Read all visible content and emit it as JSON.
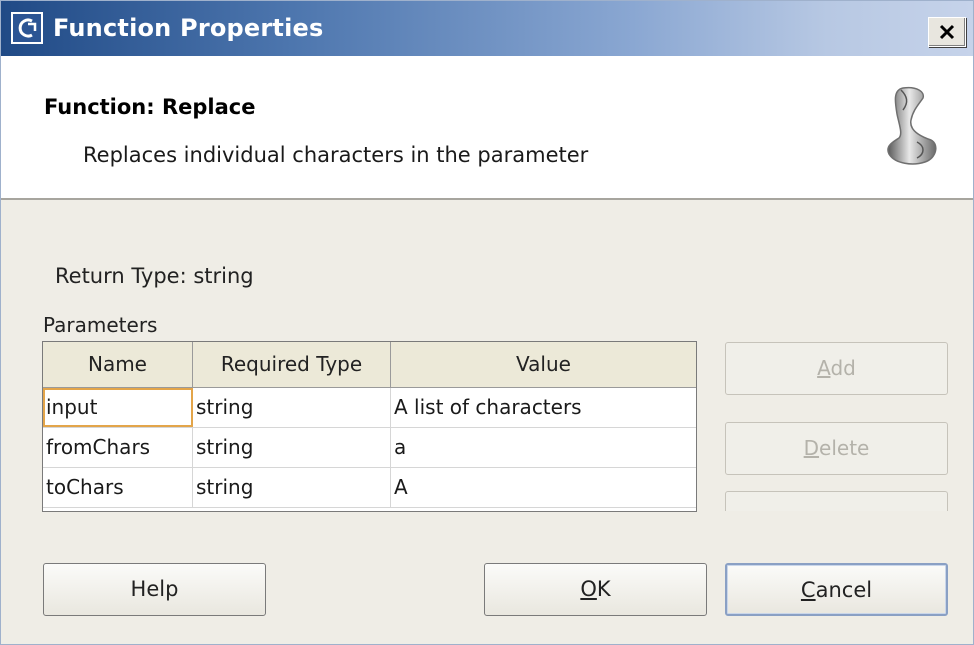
{
  "window": {
    "title": "Function Properties",
    "close_label": "×"
  },
  "header": {
    "function_title": "Function: Replace",
    "description": "Replaces individual characters in the parameter"
  },
  "body": {
    "return_type_label": "Return Type: string",
    "parameters_label": "Parameters"
  },
  "table": {
    "columns": [
      "Name",
      "Required Type",
      "Value"
    ],
    "rows": [
      {
        "name": "input",
        "type": "string",
        "value": "A list of characters"
      },
      {
        "name": "fromChars",
        "type": "string",
        "value": "a"
      },
      {
        "name": "toChars",
        "type": "string",
        "value": "A"
      }
    ]
  },
  "side_buttons": {
    "add": {
      "prefix": "",
      "mnemonic": "A",
      "rest": "dd",
      "enabled": false
    },
    "delete": {
      "prefix": "",
      "mnemonic": "D",
      "rest": "elete",
      "enabled": false
    }
  },
  "dialog_buttons": {
    "help": "Help",
    "ok": {
      "mnemonic": "O",
      "rest": "K"
    },
    "cancel": {
      "mnemonic": "C",
      "rest": "ancel"
    }
  },
  "icons": [
    "app-icon",
    "close-icon",
    "scroll-icon"
  ],
  "colors": {
    "title_bar_start": "#204a86",
    "title_bar_end": "#c6d3ea",
    "dialog_bg": "#efede6",
    "focus_outline": "#e3a54a"
  }
}
